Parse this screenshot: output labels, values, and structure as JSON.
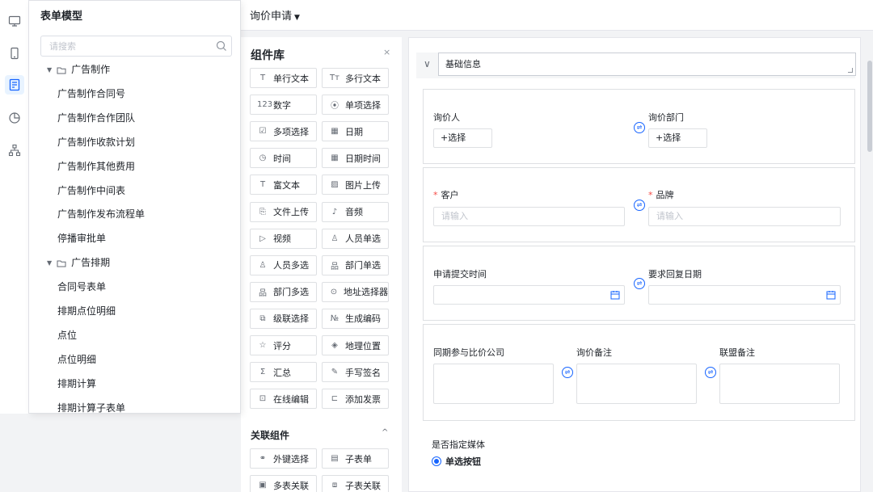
{
  "window": {
    "title": "询价申请"
  },
  "rail": {
    "icons": [
      "desktop-icon",
      "mobile-icon",
      "form-icon",
      "chart-icon",
      "org-icon"
    ]
  },
  "model_panel": {
    "title": "表单模型",
    "search_placeholder": "请搜索",
    "items": [
      {
        "kind": "group",
        "label": "广告制作"
      },
      {
        "kind": "leaf",
        "label": "广告制作合同号"
      },
      {
        "kind": "leaf",
        "label": "广告制作合作团队"
      },
      {
        "kind": "leaf",
        "label": "广告制作收款计划"
      },
      {
        "kind": "leaf",
        "label": "广告制作其他费用"
      },
      {
        "kind": "leaf",
        "label": "广告制作中间表"
      },
      {
        "kind": "leaf",
        "label": "广告制作发布流程单"
      },
      {
        "kind": "leaf",
        "label": "停播审批单"
      },
      {
        "kind": "group",
        "label": "广告排期"
      },
      {
        "kind": "leaf",
        "label": "合同号表单"
      },
      {
        "kind": "leaf",
        "label": "排期点位明细"
      },
      {
        "kind": "leaf",
        "label": "点位"
      },
      {
        "kind": "leaf",
        "label": "点位明细"
      },
      {
        "kind": "leaf",
        "label": "排期计算"
      },
      {
        "kind": "leaf",
        "label": "排期计算子表单"
      }
    ]
  },
  "library": {
    "title": "组件库",
    "close": "×",
    "components": [
      {
        "icon": "T",
        "label": "单行文本"
      },
      {
        "icon": "Tт",
        "label": "多行文本"
      },
      {
        "icon": "123",
        "label": "数字"
      },
      {
        "icon": "⦿",
        "label": "单项选择"
      },
      {
        "icon": "☑",
        "label": "多项选择"
      },
      {
        "icon": "▦",
        "label": "日期"
      },
      {
        "icon": "◷",
        "label": "时间"
      },
      {
        "icon": "▦",
        "label": "日期时间"
      },
      {
        "icon": "T",
        "label": "富文本"
      },
      {
        "icon": "▨",
        "label": "图片上传"
      },
      {
        "icon": "⎘",
        "label": "文件上传"
      },
      {
        "icon": "♪",
        "label": "音频"
      },
      {
        "icon": "▷",
        "label": "视频"
      },
      {
        "icon": "♙",
        "label": "人员单选"
      },
      {
        "icon": "♙",
        "label": "人员多选"
      },
      {
        "icon": "品",
        "label": "部门单选"
      },
      {
        "icon": "品",
        "label": "部门多选"
      },
      {
        "icon": "⊙",
        "label": "地址选择器"
      },
      {
        "icon": "⧉",
        "label": "级联选择"
      },
      {
        "icon": "№",
        "label": "生成编码"
      },
      {
        "icon": "☆",
        "label": "评分"
      },
      {
        "icon": "◈",
        "label": "地理位置"
      },
      {
        "icon": "Σ",
        "label": "汇总"
      },
      {
        "icon": "✎",
        "label": "手写签名"
      },
      {
        "icon": "⊡",
        "label": "在线编辑"
      },
      {
        "icon": "⊏",
        "label": "添加发票"
      }
    ],
    "section2": {
      "title": "关联组件",
      "caret": "^"
    },
    "related": [
      {
        "icon": "⚭",
        "label": "外键选择"
      },
      {
        "icon": "▤",
        "label": "子表单"
      },
      {
        "icon": "▣",
        "label": "多表关联"
      },
      {
        "icon": "⧈",
        "label": "子表关联"
      }
    ]
  },
  "canvas": {
    "section_title": "基础信息",
    "chevron": "∨",
    "row1": {
      "left_label": "询价人",
      "left_btn": "+选择",
      "right_label": "询价部门",
      "right_btn": "+选择"
    },
    "row2": {
      "left_label": "客户",
      "left_placeholder": "请输入",
      "right_label": "品牌",
      "right_placeholder": "请输入",
      "required_mark": "*"
    },
    "row3": {
      "left_label": "申请提交时间",
      "right_label": "要求回复日期"
    },
    "row4": {
      "col1": "同期参与比价公司",
      "col2": "询价备注",
      "col3": "联盟备注"
    },
    "radio": {
      "label": "是否指定媒体",
      "option": "单选按钮"
    },
    "swap_symbol": "⇌"
  }
}
